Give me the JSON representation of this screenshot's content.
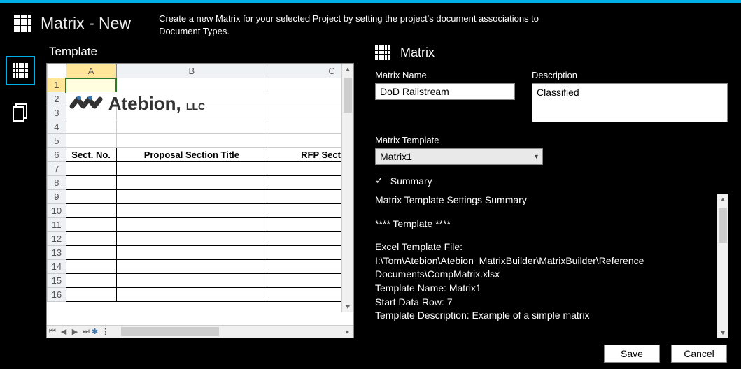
{
  "header": {
    "title": "Matrix - New",
    "subtitle": "Create a new Matrix for your selected Project by setting the project's document associations to Document Types."
  },
  "panes": {
    "left_title": "Template",
    "right_title": "Matrix"
  },
  "nav": {
    "template_icon": "grid-icon",
    "documents_icon": "documents-icon"
  },
  "sheet": {
    "columns": [
      "A",
      "B",
      "C"
    ],
    "selected_cell": "A1",
    "header_row_index": 6,
    "headers": [
      "Sect. No.",
      "Proposal Section Title",
      "RFP Section L"
    ],
    "visible_rows": 16,
    "logo_text_main": "Atebion,",
    "logo_text_suffix": "LLC"
  },
  "form": {
    "matrix_name_label": "Matrix Name",
    "matrix_name_value": "DoD Railstream",
    "description_label": "Description",
    "description_value": "Classified",
    "template_label": "Matrix Template",
    "template_value": "Matrix1",
    "summary_toggle": "Summary"
  },
  "summary": {
    "heading": "Matrix Template Settings Summary",
    "template_marker": "**** Template ****",
    "lines": {
      "file": "Excel Template File: I:\\Tom\\Atebion\\Atebion_MatrixBuilder\\MatrixBuilder\\Reference Documents\\CompMatrix.xlsx",
      "name": "Template Name: Matrix1",
      "start_row": "Start Data Row: 7",
      "desc": "Template Description: Example of a simple matrix"
    }
  },
  "footer": {
    "save": "Save",
    "cancel": "Cancel"
  }
}
